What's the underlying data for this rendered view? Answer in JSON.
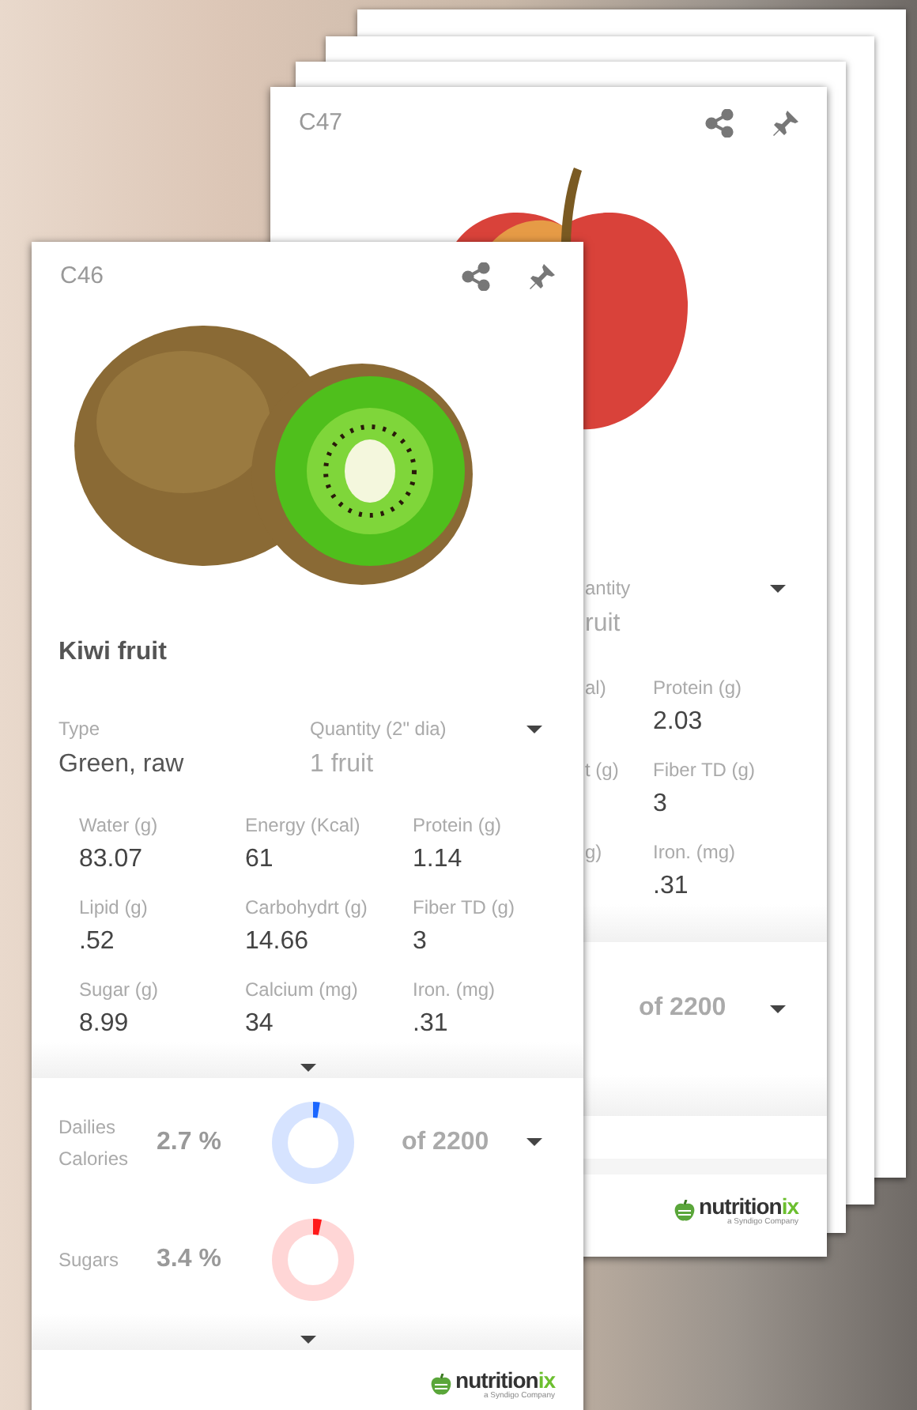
{
  "back_card": {
    "code": "C47",
    "quantity_label": "antity",
    "quantity_value": "ruit",
    "nutrients": [
      {
        "fragment": "al)",
        "label": "Protein (g)",
        "value": "2.03"
      },
      {
        "fragment": "t (g)",
        "label": "Fiber TD (g)",
        "value": "3"
      },
      {
        "fragment": "g)",
        "label": "Iron. (mg)",
        "value": ".31"
      }
    ],
    "dailies_total": "of 2200",
    "brand": {
      "name": "nutrition",
      "name_accent": "ix",
      "tagline": "a Syndigo Company"
    }
  },
  "front_card": {
    "code": "C46",
    "name": "Kiwi fruit",
    "type_label": "Type",
    "type_value": "Green, raw",
    "quantity_label": "Quantity (2\" dia)",
    "quantity_value": "1 fruit",
    "nutrients": [
      {
        "label": "Water (g)",
        "value": "83.07"
      },
      {
        "label": "Energy (Kcal)",
        "value": "61"
      },
      {
        "label": "Protein (g)",
        "value": "1.14"
      },
      {
        "label": "Lipid (g)",
        "value": ".52"
      },
      {
        "label": "Carbohydrt (g)",
        "value": "14.66"
      },
      {
        "label": "Fiber TD (g)",
        "value": "3"
      },
      {
        "label": "Sugar (g)",
        "value": "8.99"
      },
      {
        "label": "Calcium (mg)",
        "value": "34"
      },
      {
        "label": "Iron. (mg)",
        "value": ".31"
      }
    ],
    "dailies_label": "Dailies",
    "dailies": [
      {
        "label": "Calories",
        "percent": "2.7 %",
        "level": 0.027,
        "color": "#1a66ff",
        "total": "of 2200"
      },
      {
        "label": "Sugars",
        "percent": "3.4 %",
        "level": 0.034,
        "color": "#ff1a1a"
      }
    ],
    "brand": {
      "name": "nutrition",
      "name_accent": "ix",
      "tagline": "a Syndigo Company"
    }
  }
}
